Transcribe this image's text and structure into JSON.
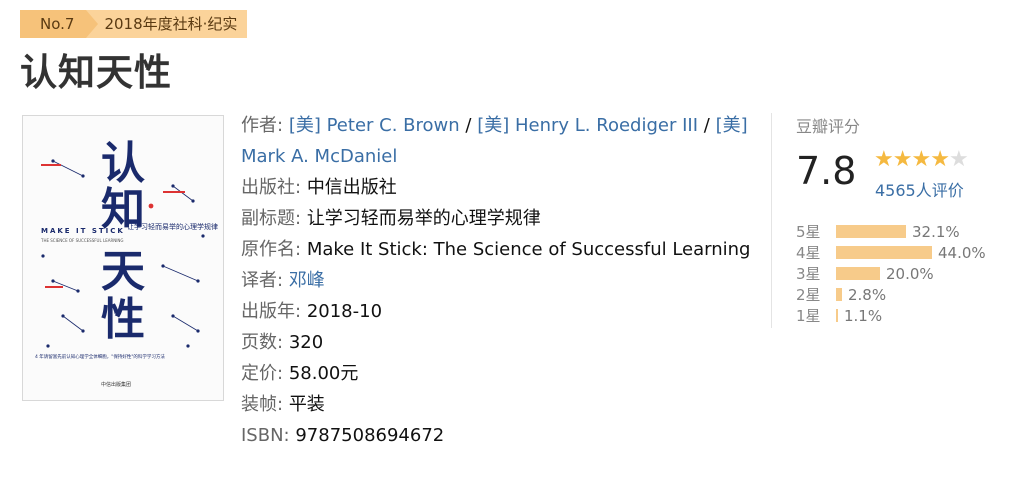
{
  "ribbon": {
    "rank": "No.7",
    "award": "2018年度社科·纪实"
  },
  "title": "认知天性",
  "cover": {
    "title_chars": [
      "认",
      "知",
      "天",
      "性"
    ],
    "english_title": "MAKE IT STICK",
    "english_subtitle": "THE SCIENCE OF SUCCESSFUL LEARNING",
    "subtitle": "让学习轻而易举的心理学规律",
    "tagline": "4 年请留富先前认知心理学全体细胞，\"保持好性\"的科学学习方法",
    "publisher": "中信出版集团",
    "accent_color": "#1a2a6c",
    "red_color": "#d33"
  },
  "info": {
    "author": {
      "label": "作者:",
      "people": [
        {
          "prefix": "[美]",
          "name": "Peter C. Brown",
          "sep": "/"
        },
        {
          "prefix": "[美]",
          "name": "Henry L. Roediger III",
          "sep": "/"
        },
        {
          "prefix": "[美]",
          "name": "Mark A. McDaniel",
          "sep": ""
        }
      ]
    },
    "publisher": {
      "label": "出版社:",
      "value": "中信出版社"
    },
    "subtitle": {
      "label": "副标题:",
      "value": "让学习轻而易举的心理学规律"
    },
    "original_title": {
      "label": "原作名:",
      "value": "Make It Stick: The Science of Successful Learning"
    },
    "translator": {
      "label": "译者:",
      "value": "邓峰"
    },
    "pub_year": {
      "label": "出版年:",
      "value": "2018-10"
    },
    "pages": {
      "label": "页数:",
      "value": "320"
    },
    "price": {
      "label": "定价:",
      "value": "58.00元"
    },
    "binding": {
      "label": "装帧:",
      "value": "平装"
    },
    "isbn": {
      "label": "ISBN:",
      "value": "9787508694672"
    }
  },
  "rating": {
    "label": "豆瓣评分",
    "score": "7.8",
    "stars_filled": 4,
    "stars_total": 5,
    "votes": "4565人评价",
    "distribution": [
      {
        "label": "5星",
        "pct": "32.1%",
        "value": 32.1
      },
      {
        "label": "4星",
        "pct": "44.0%",
        "value": 44.0
      },
      {
        "label": "3星",
        "pct": "20.0%",
        "value": 20.0
      },
      {
        "label": "2星",
        "pct": "2.8%",
        "value": 2.8
      },
      {
        "label": "1星",
        "pct": "1.1%",
        "value": 1.1
      }
    ],
    "bar_color": "#f7cb8a",
    "star_color": "#f5b940"
  }
}
